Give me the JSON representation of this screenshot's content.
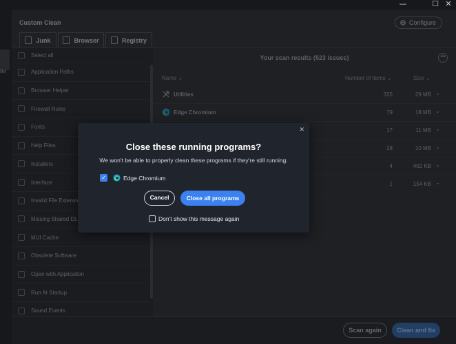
{
  "window": {
    "minimize": "—",
    "maximize": "☐",
    "close": "✕"
  },
  "leftstrip": {
    "partial_text": "ter"
  },
  "header": {
    "title": "Custom Clean",
    "configure_label": "Configure"
  },
  "tabs": [
    {
      "label": "Junk"
    },
    {
      "label": "Browser"
    },
    {
      "label": "Registry"
    }
  ],
  "categories": {
    "select_all": "Select all",
    "items": [
      "Application Paths",
      "Browser Helper",
      "Firewall Rules",
      "Fonts",
      "Help Files",
      "Installers",
      "Interface",
      "Invalid File Extension",
      "Missing Shared DLLs",
      "MUI Cache",
      "Obsolete Software",
      "Open with Application",
      "Run At Startup",
      "Sound Events"
    ]
  },
  "results": {
    "title": "Your scan results (523 issues)",
    "col_name": "Name",
    "col_count": "Number of items",
    "col_size": "Size",
    "rows": [
      {
        "name": "Utilities",
        "count": "335",
        "size": "29 MB",
        "icon": "wrench-icon"
      },
      {
        "name": "Edge Chromium",
        "count": "79",
        "size": "18 MB",
        "icon": "edge-icon"
      },
      {
        "name": "",
        "count": "17",
        "size": "11 MB",
        "icon": ""
      },
      {
        "name": "",
        "count": "28",
        "size": "10 MB",
        "icon": ""
      },
      {
        "name": "",
        "count": "4",
        "size": "402 KB",
        "icon": ""
      },
      {
        "name": "",
        "count": "1",
        "size": "154 KB",
        "icon": ""
      }
    ]
  },
  "footer": {
    "scan_again": "Scan again",
    "clean_fix": "Clean and fix"
  },
  "dialog": {
    "title": "Close these running programs?",
    "description": "We won't be able to properly clean these programs if they're still running.",
    "program": {
      "name": "Edge Chromium",
      "checked": true
    },
    "cancel_label": "Cancel",
    "close_all_label": "Close all programs",
    "dont_show_label": "Don't show this message again",
    "close_glyph": "✕"
  },
  "colors": {
    "accent": "#3b82f0",
    "dialog_bg": "#20242c",
    "background": "#2b2e32"
  }
}
